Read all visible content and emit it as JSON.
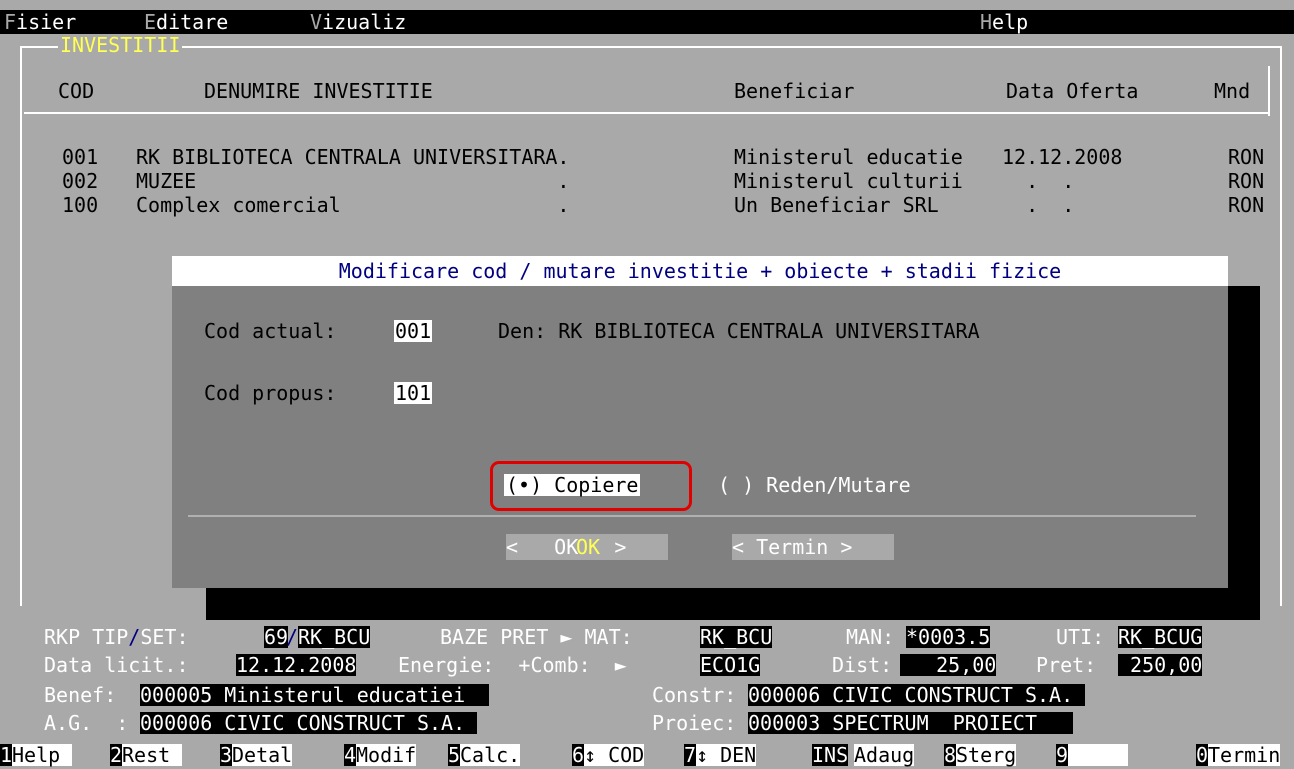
{
  "menu": {
    "items": [
      {
        "hot": "F",
        "rest": "isier"
      },
      {
        "hot": "E",
        "rest": "ditare"
      },
      {
        "hot": "V",
        "rest": "izualiz"
      },
      {
        "hot": "H",
        "rest": "elp"
      }
    ]
  },
  "table": {
    "title": "INVESTITII",
    "headers": {
      "cod": "COD",
      "den": "DENUMIRE INVESTITIE",
      "benef": "Beneficiar",
      "data": "Data Oferta",
      "mnd": "Mnd"
    },
    "rows": [
      {
        "cod": "001",
        "den": "RK BIBLIOTECA CENTRALA UNIVERSITARA.",
        "benef": "Ministerul educatie",
        "data": "12.12.2008",
        "mnd": "RON"
      },
      {
        "cod": "002",
        "den": "MUZEE                              .",
        "benef": "Ministerul culturii",
        "data": "  .  .",
        "mnd": "RON"
      },
      {
        "cod": "100",
        "den": "Complex comercial                  .",
        "benef": "Un Beneficiar SRL",
        "data": "  .  .",
        "mnd": "RON"
      }
    ]
  },
  "dialog": {
    "title": "Modificare cod / mutare investitie + obiecte + stadii fizice",
    "cod_actual_label": "Cod actual:",
    "cod_actual_value": "001",
    "den_label": "Den: RK BIBLIOTECA CENTRALA UNIVERSITARA",
    "cod_propus_label": "Cod propus:",
    "cod_propus_value": "101",
    "radio_copy": "(•) Copiere",
    "radio_move": "( ) Reden/Mutare",
    "ok_label": "<   OK   >",
    "termin_label": "< Termin >"
  },
  "info": {
    "rkp_tip": "RKP TIP",
    "set": "SET:",
    "tip_value": "69",
    "set_value": "RK_BCU",
    "baze_pret": "BAZE PRET ► MAT:",
    "mat_value": "RK_BCU",
    "man_label": "MAN:",
    "man_value": "*0003.5",
    "uti_label": "UTI:",
    "uti_value": "RK_BCUG",
    "data_licit_label": "Data licit.:",
    "data_licit_value": "12.12.2008",
    "energie_label": "Energie:  +Comb:  ►",
    "energie_value": "ECO1G",
    "dist_label": "Dist:",
    "dist_value": "   25,00",
    "pret_label": "Pret:",
    "pret_value": " 250,00",
    "benef_label": "Benef:",
    "benef_value": "000005 Ministerul educatiei  ",
    "constr_label": "Constr:",
    "constr_value": "000006 CIVIC CONSTRUCT S.A. ",
    "ag_label": "A.G.  :",
    "ag_value": "000006 CIVIC CONSTRUCT S.A. ",
    "proiec_label": "Proiec:",
    "proiec_value": "000003 SPECTRUM  PROIECT   "
  },
  "fkeys": [
    {
      "num": "1",
      "label": "Help "
    },
    {
      "num": "2",
      "label": "Rest "
    },
    {
      "num": "3",
      "label": "Detal"
    },
    {
      "num": "4",
      "label": "Modif"
    },
    {
      "num": "5",
      "label": "Calc."
    },
    {
      "num": "6",
      "label": "↕ COD"
    },
    {
      "num": "7",
      "label": "↕ DEN"
    },
    {
      "num": "INS",
      "label": "Adaug"
    },
    {
      "num": "8",
      "label": "Sterg"
    },
    {
      "num": "9",
      "label": "     "
    },
    {
      "num": "0",
      "label": "Termin"
    }
  ]
}
